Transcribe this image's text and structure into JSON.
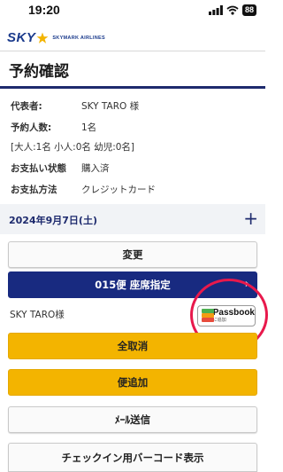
{
  "status_bar": {
    "time": "19:20",
    "battery": "88"
  },
  "brand": {
    "logo_text": "SKY",
    "logo_subtext": "SKYMARK AIRLINES"
  },
  "page": {
    "title": "予約確認"
  },
  "reservation": {
    "representative_label": "代表者:",
    "representative_value": "SKY TARO 様",
    "count_label": "予約人数:",
    "count_value": "1名",
    "breakdown": "[大人:1名 小人:0名 幼児:0名]",
    "payment_status_label": "お支払い状態",
    "payment_status_value": "購入済",
    "payment_method_label": "お支払方法",
    "payment_method_value": "クレジットカード"
  },
  "flight": {
    "date": "2024年9月7日(土)",
    "expand_symbol": "+",
    "change_label": "変更",
    "seat_label": "015便 座席指定",
    "passenger_name": "SKY TARO様",
    "passbook_title": "Passbook",
    "passbook_sub": "に追加"
  },
  "actions": {
    "cancel_all": "全取消",
    "add_flight": "便追加",
    "send_mail": "ﾒｰﾙ送信",
    "checkin_barcode": "チェックイン用バーコード表示"
  },
  "colors": {
    "navy": "#182a80",
    "yellow": "#f3b400",
    "highlight": "#e8194c"
  }
}
